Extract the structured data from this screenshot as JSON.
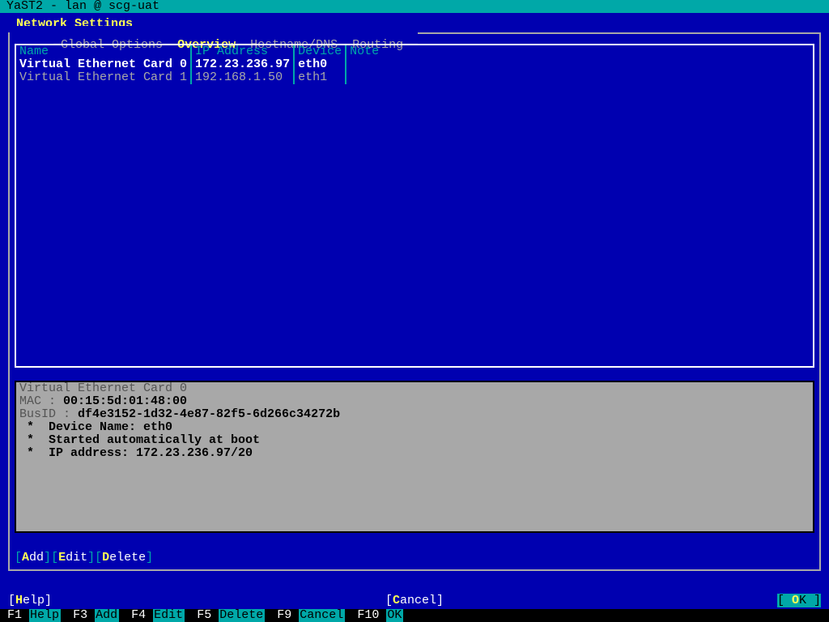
{
  "title": "YaST2 - lan @ scg-uat",
  "window_title": "Network Settings",
  "tabs": {
    "global": "Global Options",
    "overview": "Overview",
    "hostname": "Hostname/DNS",
    "routing": "Routing"
  },
  "table": {
    "headers": {
      "name": "Name",
      "ip": "IP Address",
      "device": "Device",
      "note": "Note"
    },
    "rows": [
      {
        "name": "Virtual Ethernet Card 0",
        "ip": "172.23.236.97",
        "device": "eth0",
        "note": "",
        "selected": true
      },
      {
        "name": "Virtual Ethernet Card 1",
        "ip": "192.168.1.50",
        "device": "eth1",
        "note": "",
        "selected": false
      }
    ]
  },
  "detail": {
    "title": "Virtual Ethernet Card 0",
    "mac_label": "MAC : ",
    "mac": "00:15:5d:01:48:00",
    "busid_label": "BusID : ",
    "busid": "df4e3152-1d32-4e87-82f5-6d266c34272b",
    "lines": [
      " *  Device Name: eth0",
      " *  Started automatically at boot",
      " *  IP address: 172.23.236.97/20"
    ]
  },
  "actions": {
    "add": "Add",
    "edit": "Edit",
    "delete": "Delete"
  },
  "bottom": {
    "help": "Help",
    "cancel": "Cancel",
    "ok": "OK"
  },
  "fkeys": [
    {
      "key": "F1",
      "label": "Help"
    },
    {
      "key": "F3",
      "label": "Add"
    },
    {
      "key": "F4",
      "label": "Edit"
    },
    {
      "key": "F5",
      "label": "Delete"
    },
    {
      "key": "F9",
      "label": "Cancel"
    },
    {
      "key": "F10",
      "label": "OK"
    }
  ]
}
